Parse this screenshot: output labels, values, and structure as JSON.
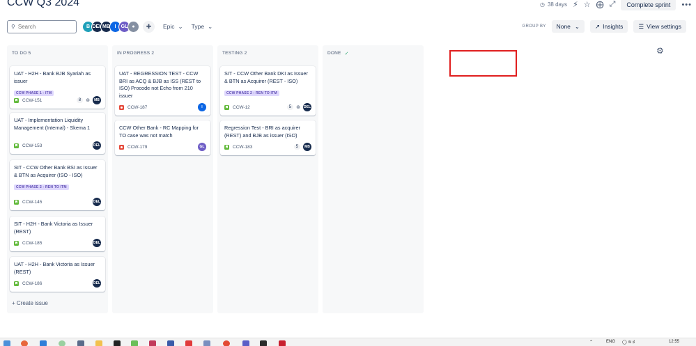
{
  "header": {
    "title": "CCW Q3 2024",
    "days_left": "38 days",
    "complete_sprint": "Complete sprint",
    "more": "•••"
  },
  "toolbar": {
    "search_placeholder": "Search",
    "avatars": [
      {
        "initials": "B",
        "color": "#1fa0b9"
      },
      {
        "initials": "DEL",
        "color": "#172b4d"
      },
      {
        "initials": "MB",
        "color": "#172b4d"
      },
      {
        "initials": "I",
        "color": "#0c66e4"
      },
      {
        "initials": "GL",
        "color": "#6e5dc6"
      },
      {
        "initials": "",
        "color": "#626f86"
      }
    ],
    "epic_label": "Epic",
    "type_label": "Type",
    "group_by_label": "GROUP BY",
    "group_by_value": "None",
    "insights_label": "Insights",
    "view_settings_label": "View settings"
  },
  "columns": [
    {
      "title": "TO DO 5",
      "create_issue": "+ Create issue",
      "cards": [
        {
          "title": "UAT - H2H - Bank BJB Syariah as issuer",
          "epic": "CCW PHASE 1 - ITM",
          "key": "CCW-151",
          "points": "8",
          "has_subtasks": true,
          "assignee": "MB",
          "assignee_color": "#172b4d",
          "type": "story"
        },
        {
          "title": "UAT - Implementation Liquidity Management (Internal) - Skema 1",
          "epic": "",
          "key": "CCW-153",
          "points": "",
          "has_subtasks": false,
          "assignee": "DEL",
          "assignee_color": "#172b4d",
          "type": "story"
        },
        {
          "title": "SIT - CCW Other Bank BSI as Issuer & BTN as Acquirer (ISO - ISO)",
          "epic": "CCW PHASE 2 - REN TO ITM",
          "key": "CCW-145",
          "points": "",
          "has_subtasks": false,
          "assignee": "DEL",
          "assignee_color": "#172b4d",
          "type": "story"
        },
        {
          "title": "SIT - H2H - Bank Victoria as Issuer (REST)",
          "epic": "",
          "key": "CCW-185",
          "points": "",
          "has_subtasks": false,
          "assignee": "DEL",
          "assignee_color": "#172b4d",
          "type": "story"
        },
        {
          "title": "UAT - H2H - Bank Victoria as Issuer (REST)",
          "epic": "",
          "key": "CCW-186",
          "points": "",
          "has_subtasks": false,
          "assignee": "DEL",
          "assignee_color": "#172b4d",
          "type": "story"
        }
      ]
    },
    {
      "title": "IN PROGRESS 2",
      "cards": [
        {
          "title": "UAT - REGRESSION TEST - CCW BRI as ACQ & BJB as ISS (REST to ISO) Procode not Echo from 210 issuer",
          "epic": "",
          "key": "CCW-187",
          "points": "",
          "has_subtasks": false,
          "assignee": "I",
          "assignee_color": "#0c66e4",
          "type": "bug"
        },
        {
          "title": "CCW Other Bank - RC Mapping for TO case was not match",
          "epic": "",
          "key": "CCW-179",
          "points": "",
          "has_subtasks": false,
          "assignee": "GL",
          "assignee_color": "#6e5dc6",
          "type": "bug"
        }
      ]
    },
    {
      "title": "TESTING 2",
      "cards": [
        {
          "title": "SIT - CCW Other Bank DKI as Issuer & BTN as Acquirer (REST - ISO)",
          "epic": "CCW PHASE 2 - REN TO ITM",
          "key": "CCW-12",
          "points": "5",
          "has_subtasks": true,
          "assignee": "DEL",
          "assignee_color": "#172b4d",
          "type": "story"
        },
        {
          "title": "Regression Test - BRI as acquirer (REST) and BJB as issuer (ISO)",
          "epic": "",
          "key": "CCW-183",
          "points": "5",
          "has_subtasks": false,
          "assignee": "MB",
          "assignee_color": "#172b4d",
          "type": "story"
        }
      ]
    },
    {
      "title": "DONE",
      "cards": []
    }
  ],
  "taskbar": {
    "lang": "ENG",
    "time": "12:55"
  }
}
